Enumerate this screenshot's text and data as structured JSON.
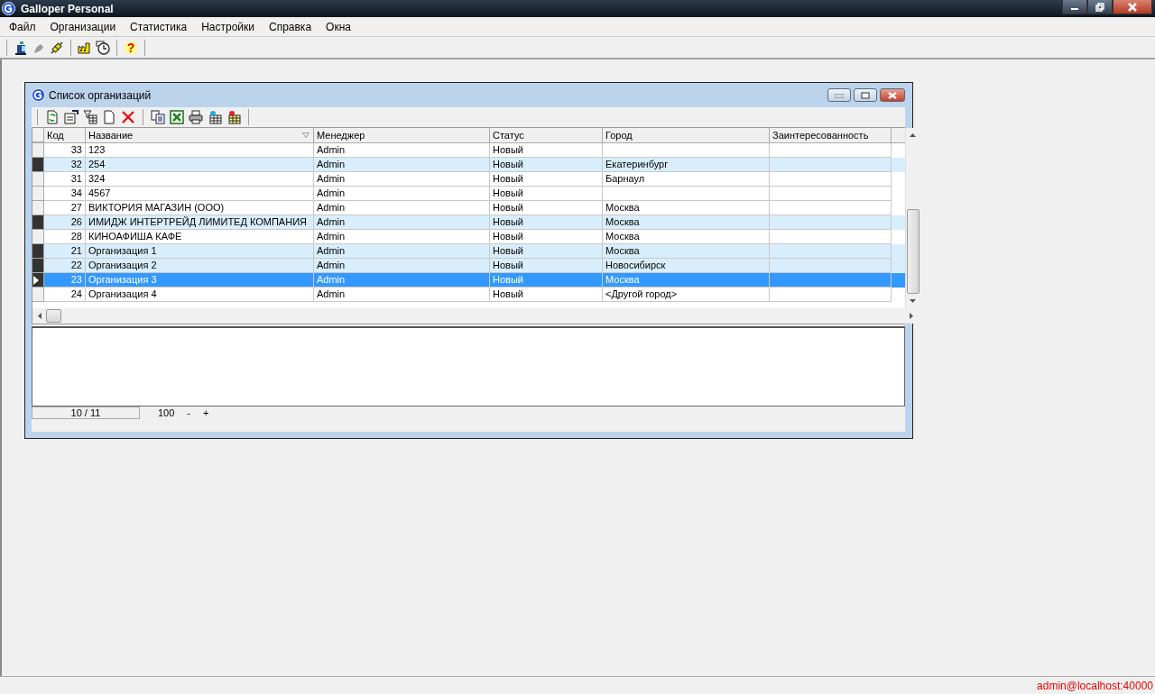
{
  "app": {
    "title": "Galloper Personal"
  },
  "menu": [
    {
      "label": "Файл"
    },
    {
      "label": "Организации"
    },
    {
      "label": "Статистика"
    },
    {
      "label": "Настройки"
    },
    {
      "label": "Справка"
    },
    {
      "label": "Окна"
    }
  ],
  "toolbar": {
    "help_glyph": "?"
  },
  "child_window": {
    "title": "Список организаций",
    "table": {
      "columns": [
        "Код",
        "Название",
        "Менеджер",
        "Статус",
        "Город",
        "Заинтересованность"
      ],
      "rows": [
        {
          "code": "33",
          "name": "123",
          "manager": "Admin",
          "status": "Новый",
          "marked": false,
          "selected": false
        },
        {
          "code": "32",
          "name": "254",
          "manager": "Admin",
          "status": "Новый",
          "city": "Екатеринбург",
          "marked": true,
          "selected": false
        },
        {
          "code": "31",
          "name": "324",
          "manager": "Admin",
          "status": "Новый",
          "city": "Барнаул",
          "marked": false,
          "selected": false
        },
        {
          "code": "34",
          "name": "4567",
          "manager": "Admin",
          "status": "Новый",
          "marked": false,
          "selected": false
        },
        {
          "code": "27",
          "name": "ВИКТОРИЯ МАГАЗИН (ООО)",
          "manager": "Admin",
          "status": "Новый",
          "city": "Москва",
          "marked": false,
          "selected": false
        },
        {
          "code": "26",
          "name": "ИМИДЖ ИНТЕРТРЕЙД ЛИМИТЕД КОМПАНИЯ",
          "manager": "Admin",
          "status": "Новый",
          "city": "Москва",
          "marked": true,
          "selected": false
        },
        {
          "code": "28",
          "name": "КИНОАФИША КАФЕ",
          "manager": "Admin",
          "status": "Новый",
          "city": "Москва",
          "marked": false,
          "selected": false
        },
        {
          "code": "21",
          "name": "Организация 1",
          "manager": "Admin",
          "status": "Новый",
          "city": "Москва",
          "marked": true,
          "selected": false
        },
        {
          "code": "22",
          "name": "Организация 2",
          "manager": "Admin",
          "status": "Новый",
          "city": "Новосибирск",
          "marked": true,
          "selected": false
        },
        {
          "code": "23",
          "name": "Организация 3",
          "manager": "Admin",
          "status": "Новый",
          "city": "Москва",
          "marked": false,
          "selected": true
        },
        {
          "code": "24",
          "name": "Организация 4",
          "manager": "Admin",
          "status": "Новый",
          "city": "<Другой город>",
          "marked": false,
          "selected": false
        }
      ]
    },
    "footer": {
      "position": "10 / 11",
      "zoom": "100",
      "zoom_out": "-",
      "zoom_in": "+"
    }
  },
  "status_bar": {
    "connection": "admin@localhost:40000"
  }
}
